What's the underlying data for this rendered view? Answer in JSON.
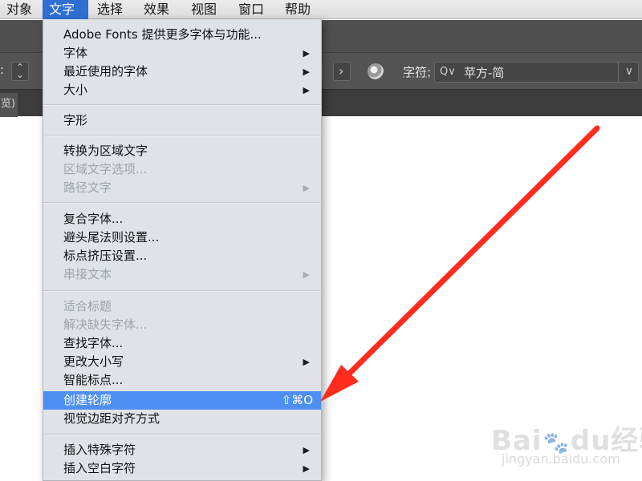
{
  "menubar": {
    "items": [
      {
        "label": "对象"
      },
      {
        "label": "文字"
      },
      {
        "label": "选择"
      },
      {
        "label": "效果"
      },
      {
        "label": "视图"
      },
      {
        "label": "窗口"
      },
      {
        "label": "帮助"
      }
    ],
    "active_label": "文字"
  },
  "options_bar": {
    "font_label": "字符:",
    "search_glyph": "Q∨",
    "font_value": "苹方-简",
    "dropdown_glyph": "∨",
    "next_glyph": "›",
    "stepper_glyph": "⌃⌄",
    "left_colon": ":"
  },
  "tab_bar": {
    "partial_tab_label": "览)"
  },
  "menu": {
    "items": [
      {
        "label": "Adobe Fonts 提供更多字体与功能...",
        "enabled": true
      },
      {
        "label": "字体",
        "submenu": true,
        "enabled": true
      },
      {
        "label": "最近使用的字体",
        "submenu": true,
        "enabled": true
      },
      {
        "label": "大小",
        "submenu": true,
        "enabled": true
      },
      {
        "label": "字形",
        "enabled": true
      },
      {
        "label": "转换为区域文字",
        "enabled": true
      },
      {
        "label": "区域文字选项...",
        "enabled": false
      },
      {
        "label": "路径文字",
        "submenu": true,
        "enabled": false
      },
      {
        "label": "复合字体...",
        "enabled": true
      },
      {
        "label": "避头尾法则设置...",
        "enabled": true
      },
      {
        "label": "标点挤压设置...",
        "enabled": true
      },
      {
        "label": "串接文本",
        "submenu": true,
        "enabled": false
      },
      {
        "label": "适合标题",
        "enabled": false
      },
      {
        "label": "解决缺失字体...",
        "enabled": false
      },
      {
        "label": "查找字体...",
        "enabled": true
      },
      {
        "label": "更改大小写",
        "submenu": true,
        "enabled": true
      },
      {
        "label": "智能标点...",
        "enabled": true
      },
      {
        "label": "创建轮廓",
        "shortcut": "⇧⌘O",
        "highlighted": true,
        "enabled": true
      },
      {
        "label": "视觉边距对齐方式",
        "enabled": true
      },
      {
        "label": "插入特殊字符",
        "submenu": true,
        "enabled": true
      },
      {
        "label": "插入空白字符",
        "submenu": true,
        "enabled": true
      }
    ],
    "submenu_arrow": "▶"
  },
  "watermark": {
    "logo": "Bai du 经验",
    "url": "jingyan.baidu.com"
  },
  "colors": {
    "menu_bg": "#dfe3e8",
    "highlight": "#4e8ff4",
    "active_menubar": "#2f6fd3",
    "annotation_arrow": "#ff2d1f",
    "disabled_text": "#a0a4a9"
  }
}
